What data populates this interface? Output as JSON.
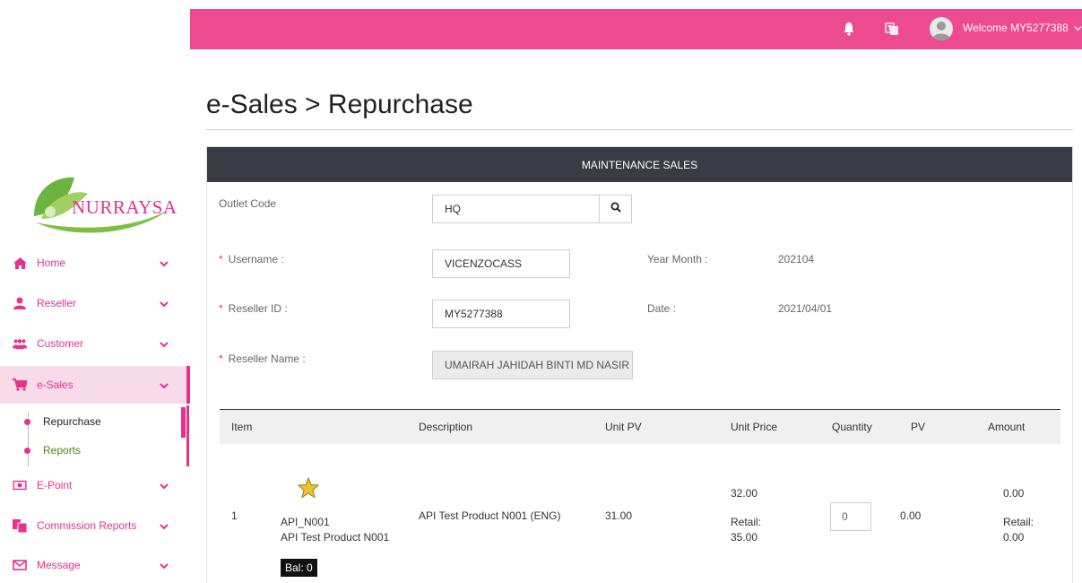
{
  "brand": {
    "logo_text": "NURRAYSA",
    "accent": "#e8318c",
    "topbar_color": "#ee4a90"
  },
  "topbar": {
    "welcome": "Welcome MY5277388",
    "icons": [
      "bell-icon",
      "language-icon",
      "avatar"
    ]
  },
  "sidebar": {
    "items": [
      {
        "label": "Home",
        "icon": "home-icon"
      },
      {
        "label": "Reseller",
        "icon": "user-icon"
      },
      {
        "label": "Customer",
        "icon": "users-icon"
      },
      {
        "label": "e-Sales",
        "icon": "cart-icon"
      },
      {
        "label": "E-Point",
        "icon": "money-icon"
      },
      {
        "label": "Commission Reports",
        "icon": "files-icon"
      },
      {
        "label": "Message",
        "icon": "envelope-icon"
      }
    ],
    "submenu": [
      {
        "label": "Repurchase"
      },
      {
        "label": "Reports"
      }
    ]
  },
  "page": {
    "title": "e-Sales > Repurchase",
    "panel_title": "MAINTENANCE SALES"
  },
  "form": {
    "outlet_code_label": "Outlet Code",
    "outlet_code_value": "HQ",
    "username_label": "Username :",
    "username_value": "VICENZOCASS",
    "reseller_id_label": "Reseller ID :",
    "reseller_id_value": "MY5277388",
    "reseller_name_label": "Reseller Name :",
    "reseller_name_value": "UMAIRAH JAHIDAH BINTI MD NASIR",
    "year_month_label": "Year Month :",
    "year_month_value": "202104",
    "date_label": "Date :",
    "date_value": "2021/04/01",
    "required_mark": "*"
  },
  "table": {
    "headers": [
      "Item",
      "Description",
      "Unit PV",
      "Unit Price",
      "Quantity",
      "PV",
      "Amount"
    ],
    "rows": [
      {
        "item_no": "1",
        "code": "API_N001",
        "name": "API Test Product N001",
        "balance": "Bal: 0",
        "description": "API Test Product N001 (ENG)",
        "unit_pv": "31.00",
        "unit_price": "32.00",
        "retail_label": "Retail:",
        "retail_price": "35.00",
        "quantity": "0",
        "pv": "0.00",
        "amount": "0.00",
        "amount_retail_label": "Retail:",
        "amount_retail": "0.00"
      }
    ]
  }
}
